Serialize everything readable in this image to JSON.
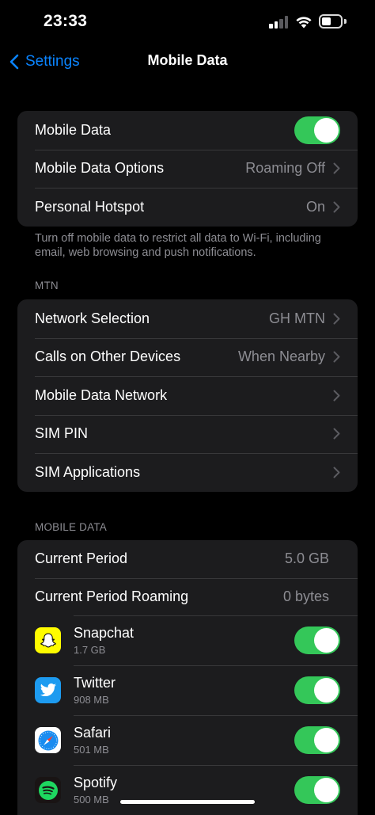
{
  "status": {
    "time": "23:33"
  },
  "nav": {
    "back_label": "Settings",
    "title": "Mobile Data"
  },
  "group1": {
    "mobile_data_label": "Mobile Data",
    "options_label": "Mobile Data Options",
    "options_value": "Roaming Off",
    "hotspot_label": "Personal Hotspot",
    "hotspot_value": "On"
  },
  "note": "Turn off mobile data to restrict all data to Wi-Fi, including email, web browsing and push notifications.",
  "carrier": {
    "header": "MTN",
    "network_label": "Network Selection",
    "network_value": "GH MTN",
    "calls_label": "Calls on Other Devices",
    "calls_value": "When Nearby",
    "data_network_label": "Mobile Data Network",
    "sim_pin_label": "SIM PIN",
    "sim_apps_label": "SIM Applications"
  },
  "usage": {
    "header": "MOBILE DATA",
    "current_label": "Current Period",
    "current_value": "5.0 GB",
    "roaming_label": "Current Period Roaming",
    "roaming_value": "0 bytes"
  },
  "apps": [
    {
      "name": "Snapchat",
      "usage": "1.7 GB",
      "icon": "snapchat-icon",
      "enabled": true
    },
    {
      "name": "Twitter",
      "usage": "908 MB",
      "icon": "twitter-icon",
      "enabled": true
    },
    {
      "name": "Safari",
      "usage": "501 MB",
      "icon": "safari-icon",
      "enabled": true
    },
    {
      "name": "Spotify",
      "usage": "500 MB",
      "icon": "spotify-icon",
      "enabled": true
    }
  ],
  "colors": {
    "accent": "#0a84ff",
    "toggle_on": "#34c759",
    "cell_bg": "#1c1c1e",
    "secondary_text": "#8d8d93"
  }
}
